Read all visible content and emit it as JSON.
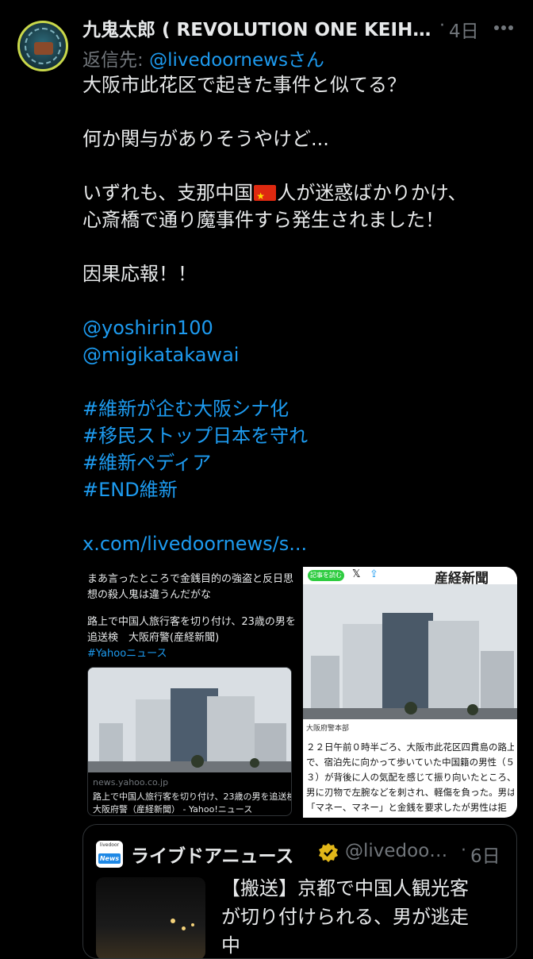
{
  "post": {
    "author_name": "九鬼太郎 ( REVOLUTION ONE KEIH…",
    "dot": "·",
    "time": "4日",
    "reply_prefix": "返信先: ",
    "reply_handle": "@livedoornewsさん",
    "lines": {
      "l1": "大阪市此花区で起きた事件と似てる？",
      "l2": "何か関与がありそうやけど...",
      "l3a": "いずれも、支那中国",
      "l3b": "人が迷惑ばかりかけ、",
      "l4": "心斎橋で通り魔事件すら発生されました！",
      "l5": "因果応報！！",
      "mention1": "@yoshirin100",
      "mention2": "@migikatakawai",
      "tag1": "#維新が企む大阪シナ化",
      "tag2": "#移民ストップ日本を守れ",
      "tag3": "#維新ペディア",
      "tag4": "#END維新",
      "url": "x.com/livedoornews/s..."
    }
  },
  "media": {
    "left": {
      "text1": "まあ言ったところで金銭目的の強盗と反日思",
      "text2": "想の殺人鬼は違うんだがな",
      "text3": "路上で中国人旅行客を切り付け、23歳の男を",
      "text4": "追送検　大阪府警(産経新聞)",
      "tag": "#Yahooニュース",
      "card_domain": "news.yahoo.co.jp",
      "card_title1": "路上で中国人旅行客を切り付け、23歳の男を追送検",
      "card_title2": "大阪府警（産経新聞） - Yahoo!ニュース"
    },
    "right": {
      "pill": "記事を読む",
      "masthead": "産経新聞",
      "credit": "大阪府警本部",
      "a1": "２２日午前０時半ごろ、大阪市此花区四貫島の路上",
      "a2": "で、宿泊先に向かって歩いていた中国籍の男性（５",
      "a3": "３）が背後に人の気配を感じて振り向いたところ、",
      "a4": "男に刃物で左腕などを刺され、軽傷を負った。男は",
      "a5": "「マネー、マネー」と金銭を要求したが男性は拒"
    }
  },
  "quote": {
    "avatar_top": "livedoor",
    "avatar_logo": "News",
    "name": "ライブドアニュース",
    "handle": "@livedoo…",
    "dot": "·",
    "time": "6日",
    "l1": "【搬送】京都で中国人観光客",
    "l2": "が切り付けられる、男が逃走",
    "l3": "中"
  },
  "colors": {
    "background": "#000000",
    "text": "#e7e9ea",
    "muted": "#71767b",
    "link": "#1d9bf0",
    "verified_gold": "#e2b719"
  },
  "icons": {
    "more": "more-horizontal-icon",
    "verified": "verified-badge-icon",
    "flag": "china-flag-emoji"
  }
}
